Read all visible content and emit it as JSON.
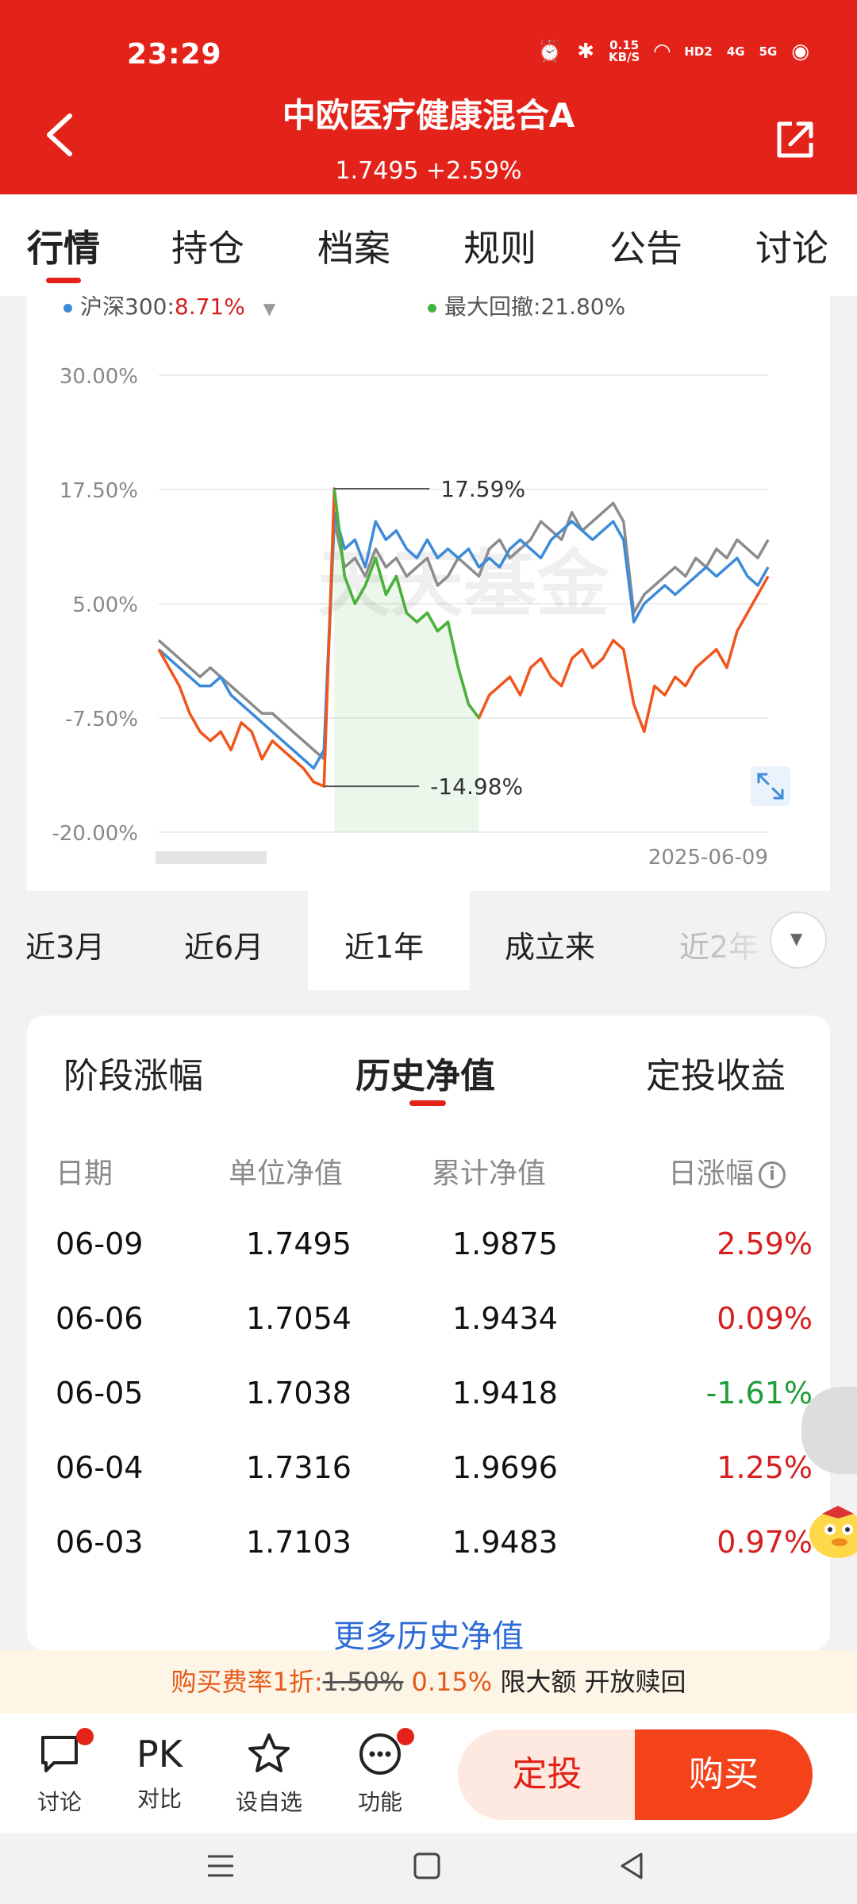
{
  "status_bar": {
    "time": "23:29",
    "speed_value": "0.15",
    "speed_unit": "KB/S",
    "hd": "HD2",
    "net1": "4G",
    "net2": "5G"
  },
  "header": {
    "title": "中欧医疗健康混合A",
    "subtitle": "1.7495 +2.59%"
  },
  "tabs": [
    "行情",
    "持仓",
    "档案",
    "规则",
    "公告",
    "讨论"
  ],
  "legend": {
    "benchmark_label": "沪深300:",
    "benchmark_value": "8.71%",
    "drawdown_label": "最大回撤:",
    "drawdown_value": "21.80%"
  },
  "colors": {
    "brand_red": "#e3231a",
    "fund_orange": "#f0561c",
    "hs300_blue": "#3d8bd8",
    "peer_gray": "#8c8c8c",
    "drawdown_green": "#45b53f",
    "up_red": "#d61f1f",
    "down_green": "#1e9e3a",
    "link_blue": "#2e6bd6"
  },
  "chart_data": {
    "type": "line",
    "y_ticks": [
      "30.00%",
      "17.50%",
      "5.00%",
      "-7.50%",
      "-20.00%"
    ],
    "ylim": [
      -20,
      30
    ],
    "x_end_label": "2025-06-09",
    "annotations": [
      "17.59%",
      "-14.98%"
    ],
    "watermark": "天天基金",
    "x": [
      0,
      1,
      2,
      3,
      4,
      5,
      6,
      7,
      8,
      9,
      10,
      11,
      12,
      13,
      14,
      15,
      16,
      17,
      18,
      19,
      20,
      21,
      22,
      23,
      24,
      25,
      26,
      27,
      28,
      29,
      30,
      31,
      32,
      33,
      34,
      35,
      36,
      37,
      38,
      39,
      40,
      41,
      42,
      43,
      44,
      45,
      46,
      47,
      48,
      49,
      50,
      51,
      52,
      53,
      54,
      55,
      56,
      57,
      58,
      59
    ],
    "series": [
      {
        "key": "fund",
        "values": [
          0,
          -2,
          -4,
          -7,
          -9,
          -10,
          -9,
          -11,
          -8,
          -9,
          -12,
          -10,
          -11,
          -12,
          -13,
          -14.5,
          -14.98,
          17.59,
          8,
          5,
          7,
          10,
          6,
          8,
          4,
          3,
          4,
          2,
          3,
          -2,
          -6,
          -7.5,
          -5,
          -4,
          -3,
          -5,
          -2,
          -1,
          -3,
          -4,
          -1,
          0,
          -2,
          -1,
          1,
          0,
          -6,
          -9,
          -4,
          -5,
          -3,
          -4,
          -2,
          -1,
          0,
          -2,
          2,
          4,
          6,
          8
        ],
        "flags": {
          "drawdown_start": 17,
          "drawdown_end": 31
        }
      },
      {
        "key": "hs300",
        "values": [
          0,
          -1,
          -2,
          -3,
          -4,
          -4,
          -3,
          -5,
          -6,
          -7,
          -8,
          -9,
          -10,
          -11,
          -12,
          -13,
          -11,
          15,
          11,
          12,
          9,
          14,
          12,
          13,
          11,
          10,
          12,
          10,
          11,
          10,
          11,
          9,
          10,
          9,
          11,
          12,
          11,
          10,
          12,
          13,
          14,
          13,
          12,
          13,
          14,
          12,
          3,
          5,
          6,
          7,
          6,
          7,
          8,
          9,
          8,
          9,
          10,
          8,
          7,
          9
        ]
      },
      {
        "key": "peer",
        "values": [
          1,
          0,
          -1,
          -2,
          -3,
          -2,
          -3,
          -4,
          -5,
          -6,
          -7,
          -7,
          -8,
          -9,
          -10,
          -11,
          -12,
          14,
          9,
          10,
          8,
          11,
          9,
          10,
          8,
          9,
          10,
          7,
          8,
          10,
          9,
          8,
          11,
          12,
          10,
          11,
          12,
          14,
          13,
          12,
          15,
          13,
          14,
          15,
          16,
          14,
          4,
          6,
          7,
          8,
          9,
          8,
          10,
          9,
          11,
          10,
          12,
          11,
          10,
          12
        ]
      }
    ]
  },
  "periods": [
    "近3月",
    "近6月",
    "近1年",
    "成立来",
    "近2年"
  ],
  "nav_tabs": [
    "阶段涨幅",
    "历史净值",
    "定投收益"
  ],
  "table": {
    "headers": [
      "日期",
      "单位净值",
      "累计净值",
      "日涨幅"
    ],
    "rows": [
      {
        "date": "06-09",
        "unit": "1.7495",
        "acc": "1.9875",
        "chg": "2.59%",
        "dir": "up"
      },
      {
        "date": "06-06",
        "unit": "1.7054",
        "acc": "1.9434",
        "chg": "0.09%",
        "dir": "up"
      },
      {
        "date": "06-05",
        "unit": "1.7038",
        "acc": "1.9418",
        "chg": "-1.61%",
        "dir": "down"
      },
      {
        "date": "06-04",
        "unit": "1.7316",
        "acc": "1.9696",
        "chg": "1.25%",
        "dir": "up"
      },
      {
        "date": "06-03",
        "unit": "1.7103",
        "acc": "1.9483",
        "chg": "0.97%",
        "dir": "up"
      }
    ],
    "more": "更多历史净值"
  },
  "promo": {
    "prefix": "购买费率1折:",
    "old_rate": "1.50%",
    "new_rate": "0.15%",
    "suffix": "限大额 开放赎回"
  },
  "bottom": {
    "items": [
      {
        "label": "讨论",
        "icon": "chat-icon"
      },
      {
        "label": "对比",
        "icon_text": "PK"
      },
      {
        "label": "设自选",
        "icon": "star-icon"
      },
      {
        "label": "功能",
        "icon": "more-icon"
      }
    ],
    "dingtou": "定投",
    "buy": "购买"
  }
}
